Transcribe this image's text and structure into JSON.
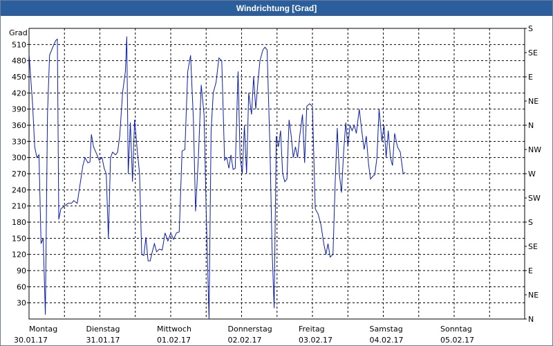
{
  "window": {
    "title": "Windrichtung [Grad]"
  },
  "colors": {
    "title_bar": "#2a5e9c",
    "series": "#0a1cb0",
    "grid": "#000000"
  },
  "chart_data": {
    "type": "line",
    "title": "Windrichtung [Grad]",
    "ylabel": "Grad",
    "ylim": [
      0,
      540
    ],
    "yticks": [
      30,
      60,
      90,
      120,
      150,
      180,
      210,
      240,
      270,
      300,
      330,
      360,
      390,
      420,
      450,
      480,
      510
    ],
    "right_axis_labels": [
      {
        "value": 0,
        "label": "N"
      },
      {
        "value": 45,
        "label": "NE"
      },
      {
        "value": 90,
        "label": "E"
      },
      {
        "value": 135,
        "label": "SE"
      },
      {
        "value": 180,
        "label": "S"
      },
      {
        "value": 225,
        "label": "SW"
      },
      {
        "value": 270,
        "label": "W"
      },
      {
        "value": 315,
        "label": "NW"
      },
      {
        "value": 360,
        "label": "N"
      },
      {
        "value": 405,
        "label": "NE"
      },
      {
        "value": 450,
        "label": "E"
      },
      {
        "value": 495,
        "label": "SE"
      },
      {
        "value": 540,
        "label": "S"
      }
    ],
    "xlim": [
      0,
      7
    ],
    "x_labels": [
      {
        "day": "Montag",
        "date": "30.01.17"
      },
      {
        "day": "Dienstag",
        "date": "31.01.17"
      },
      {
        "day": "Mittwoch",
        "date": "01.02.17"
      },
      {
        "day": "Donnerstag",
        "date": "02.02.17"
      },
      {
        "day": "Freitag",
        "date": "03.02.17"
      },
      {
        "day": "Samstag",
        "date": "04.02.17"
      },
      {
        "day": "Sonntag",
        "date": "05.02.17"
      }
    ],
    "grid": true,
    "series": [
      {
        "values": [
          [
            0.0,
            493
          ],
          [
            0.05,
            400
          ],
          [
            0.08,
            320
          ],
          [
            0.11,
            300
          ],
          [
            0.14,
            305
          ],
          [
            0.17,
            140
          ],
          [
            0.2,
            150
          ],
          [
            0.23,
            8
          ],
          [
            0.26,
            380
          ],
          [
            0.29,
            490
          ],
          [
            0.32,
            500
          ],
          [
            0.35,
            510
          ],
          [
            0.38,
            518
          ],
          [
            0.4,
            520
          ],
          [
            0.42,
            185
          ],
          [
            0.45,
            205
          ],
          [
            0.5,
            210
          ],
          [
            0.55,
            215
          ],
          [
            0.6,
            215
          ],
          [
            0.63,
            220
          ],
          [
            0.68,
            215
          ],
          [
            0.72,
            250
          ],
          [
            0.76,
            285
          ],
          [
            0.79,
            300
          ],
          [
            0.83,
            290
          ],
          [
            0.86,
            292
          ],
          [
            0.88,
            343
          ],
          [
            0.91,
            320
          ],
          [
            0.96,
            305
          ],
          [
            0.99,
            295
          ],
          [
            1.03,
            300
          ],
          [
            1.06,
            280
          ],
          [
            1.09,
            270
          ],
          [
            1.12,
            150
          ],
          [
            1.15,
            300
          ],
          [
            1.18,
            310
          ],
          [
            1.22,
            305
          ],
          [
            1.25,
            310
          ],
          [
            1.28,
            340
          ],
          [
            1.32,
            420
          ],
          [
            1.36,
            460
          ],
          [
            1.38,
            525
          ],
          [
            1.4,
            270
          ],
          [
            1.43,
            365
          ],
          [
            1.46,
            255
          ],
          [
            1.49,
            370
          ],
          [
            1.53,
            310
          ],
          [
            1.56,
            270
          ],
          [
            1.59,
            120
          ],
          [
            1.62,
            118
          ],
          [
            1.65,
            152
          ],
          [
            1.68,
            108
          ],
          [
            1.71,
            108
          ],
          [
            1.74,
            125
          ],
          [
            1.77,
            140
          ],
          [
            1.8,
            125
          ],
          [
            1.84,
            130
          ],
          [
            1.88,
            128
          ],
          [
            1.92,
            160
          ],
          [
            1.96,
            145
          ],
          [
            2.0,
            160
          ],
          [
            2.04,
            148
          ],
          [
            2.08,
            160
          ],
          [
            2.12,
            162
          ],
          [
            2.16,
            312
          ],
          [
            2.2,
            315
          ],
          [
            2.24,
            460
          ],
          [
            2.28,
            490
          ],
          [
            2.32,
            370
          ],
          [
            2.35,
            200
          ],
          [
            2.39,
            300
          ],
          [
            2.43,
            435
          ],
          [
            2.47,
            380
          ],
          [
            2.5,
            200
          ],
          [
            2.54,
            0
          ],
          [
            2.57,
            350
          ],
          [
            2.6,
            420
          ],
          [
            2.64,
            440
          ],
          [
            2.68,
            485
          ],
          [
            2.72,
            480
          ],
          [
            2.76,
            295
          ],
          [
            2.79,
            300
          ],
          [
            2.82,
            280
          ],
          [
            2.85,
            305
          ],
          [
            2.88,
            278
          ],
          [
            2.91,
            280
          ],
          [
            2.95,
            460
          ],
          [
            2.98,
            300
          ],
          [
            3.01,
            270
          ],
          [
            3.04,
            360
          ],
          [
            3.07,
            270
          ],
          [
            3.1,
            420
          ],
          [
            3.14,
            380
          ],
          [
            3.17,
            450
          ],
          [
            3.2,
            390
          ],
          [
            3.23,
            440
          ],
          [
            3.26,
            480
          ],
          [
            3.3,
            500
          ],
          [
            3.33,
            505
          ],
          [
            3.36,
            500
          ],
          [
            3.4,
            320
          ],
          [
            3.43,
            130
          ],
          [
            3.46,
            20
          ],
          [
            3.49,
            340
          ],
          [
            3.52,
            320
          ],
          [
            3.55,
            350
          ],
          [
            3.58,
            270
          ],
          [
            3.61,
            255
          ],
          [
            3.64,
            260
          ],
          [
            3.67,
            370
          ],
          [
            3.7,
            340
          ],
          [
            3.73,
            300
          ],
          [
            3.76,
            320
          ],
          [
            3.79,
            300
          ],
          [
            3.82,
            340
          ],
          [
            3.86,
            380
          ],
          [
            3.89,
            290
          ],
          [
            3.92,
            395
          ],
          [
            3.96,
            400
          ],
          [
            4.0,
            395
          ],
          [
            4.04,
            205
          ],
          [
            4.08,
            195
          ],
          [
            4.12,
            175
          ],
          [
            4.16,
            140
          ],
          [
            4.19,
            120
          ],
          [
            4.22,
            140
          ],
          [
            4.25,
            115
          ],
          [
            4.29,
            120
          ],
          [
            4.32,
            250
          ],
          [
            4.35,
            355
          ],
          [
            4.38,
            270
          ],
          [
            4.41,
            235
          ],
          [
            4.44,
            310
          ],
          [
            4.47,
            365
          ],
          [
            4.5,
            320
          ],
          [
            4.53,
            360
          ],
          [
            4.56,
            350
          ],
          [
            4.59,
            360
          ],
          [
            4.62,
            345
          ],
          [
            4.66,
            390
          ],
          [
            4.7,
            345
          ],
          [
            4.73,
            315
          ],
          [
            4.76,
            340
          ],
          [
            4.79,
            290
          ],
          [
            4.82,
            260
          ],
          [
            4.85,
            265
          ],
          [
            4.88,
            268
          ],
          [
            4.91,
            300
          ],
          [
            4.94,
            390
          ],
          [
            4.98,
            330
          ],
          [
            5.01,
            360
          ],
          [
            5.04,
            300
          ],
          [
            5.07,
            350
          ],
          [
            5.1,
            300
          ],
          [
            5.13,
            285
          ],
          [
            5.16,
            345
          ],
          [
            5.2,
            320
          ],
          [
            5.24,
            310
          ],
          [
            5.28,
            270
          ],
          [
            5.31,
            272
          ]
        ]
      }
    ]
  }
}
